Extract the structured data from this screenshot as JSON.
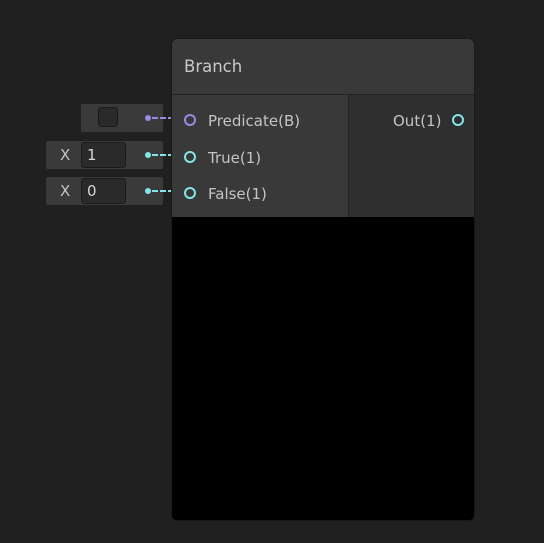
{
  "node": {
    "title": "Branch",
    "inputs": [
      {
        "label": "Predicate(B)",
        "type": "boolean",
        "color": "#9c8ae0"
      },
      {
        "label": "True(1)",
        "type": "float",
        "color": "#84e4e7"
      },
      {
        "label": "False(1)",
        "type": "float",
        "color": "#84e4e7"
      }
    ],
    "outputs": [
      {
        "label": "Out(1)",
        "color": "#84e4e7"
      }
    ]
  },
  "input_fields": {
    "predicate": {
      "checked": false
    },
    "true_value": {
      "axis_label": "X",
      "value": "1"
    },
    "false_value": {
      "axis_label": "X",
      "value": "0"
    }
  },
  "colors": {
    "background": "#202020",
    "node_header": "#393939",
    "preview": "#000000",
    "boolean_port": "#9c8ae0",
    "float_port": "#84e4e7"
  }
}
